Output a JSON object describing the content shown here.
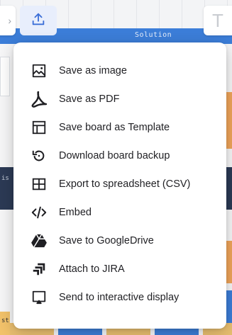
{
  "board": {
    "column_label": "Solution",
    "side_label_1": "is",
    "side_label_2": "st"
  },
  "toolbar": {
    "right_tool_glyph": "T",
    "export_icon": "upload-icon"
  },
  "export_menu": {
    "items": [
      {
        "label": "Save as image",
        "icon": "image-icon"
      },
      {
        "label": "Save as PDF",
        "icon": "pdf-icon"
      },
      {
        "label": "Save board as Template",
        "icon": "template-icon"
      },
      {
        "label": "Download board backup",
        "icon": "backup-icon"
      },
      {
        "label": "Export to spreadsheet (CSV)",
        "icon": "spreadsheet-icon"
      },
      {
        "label": "Embed",
        "icon": "embed-code-icon"
      },
      {
        "label": "Save to GoogleDrive",
        "icon": "google-drive-icon"
      },
      {
        "label": "Attach to JIRA",
        "icon": "jira-icon"
      },
      {
        "label": "Send to interactive display",
        "icon": "display-icon"
      }
    ]
  },
  "colors": {
    "accent_blue": "#3c7ed9",
    "export_button_bg": "#e8eefc",
    "sticky_orange": "#f0a55a",
    "menu_text": "#1f1f23"
  }
}
